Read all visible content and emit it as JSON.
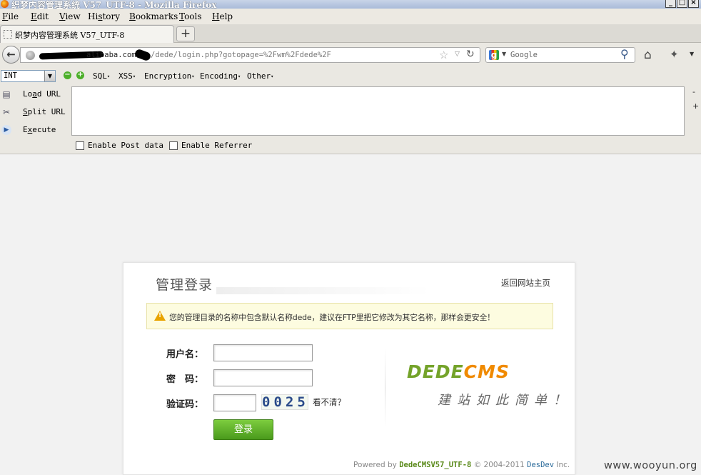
{
  "window": {
    "title": "织梦内容管理系统 V57_UTF-8 - Mozilla Firefox",
    "controls": {
      "minimize": "_",
      "maximize": "□",
      "close": "×"
    }
  },
  "menubar": {
    "items": [
      {
        "label": "File",
        "accel": "F",
        "rest": "ile"
      },
      {
        "label": "Edit",
        "accel": "E",
        "rest": "dit"
      },
      {
        "label": "View",
        "accel": "V",
        "rest": "iew"
      },
      {
        "label": "History",
        "pre": "Hi",
        "accel": "s",
        "rest": "tory"
      },
      {
        "label": "Bookmarks",
        "accel": "B",
        "rest": "ookmarks"
      },
      {
        "label": "Tools",
        "accel": "T",
        "rest": "ools"
      },
      {
        "label": "Help",
        "accel": "H",
        "rest": "elp"
      }
    ]
  },
  "tabs": [
    {
      "title": "织梦内容管理系统 V57_UTF-8",
      "active": true
    }
  ],
  "new_tab": "+",
  "nav": {
    "back": "←",
    "url_host": "alibaba.com",
    "url_path": "/dede/login.php?gotopage=%2Fwm%2Fdede%2F",
    "star": "☆",
    "dropdown": "▽",
    "reload": "↻",
    "search_placeholder": "Google",
    "search_engine_icon": "google-icon",
    "home": "⌂",
    "addon": "✦"
  },
  "hackbar": {
    "type_select": "INT",
    "menus": [
      "SQL",
      "XSS",
      "Encryption",
      "Encoding",
      "Other"
    ],
    "actions": [
      {
        "pre": "Lo",
        "accel": "a",
        "rest": "d URL",
        "icon": "load-url-icon"
      },
      {
        "pre": "",
        "accel": "S",
        "rest": "plit URL",
        "icon": "split-url-icon"
      },
      {
        "pre": "E",
        "accel": "x",
        "rest": "ecute",
        "icon": "execute-icon"
      }
    ],
    "checkboxes": [
      "Enable Post data",
      "Enable Referrer"
    ],
    "side_minus": "-",
    "side_plus": "+"
  },
  "login": {
    "title": "管理登录",
    "home_link": "返回网站主页",
    "notice": "您的管理目录的名称中包含默认名称dede，建议在FTP里把它修改为其它名称，那样会更安全！",
    "username_label": "用户名：",
    "password_label": "密　码：",
    "captcha_label": "验证码：",
    "captcha_code": "0025",
    "captcha_refresh": "看不清？",
    "submit": "登录",
    "logo_dede": "DEDE",
    "logo_cms": "CMS",
    "slogan": "建站如此简单！",
    "footer_powered": "Powered by",
    "footer_product": "DedeCMSV57_UTF-8",
    "footer_copy": "© 2004-2011",
    "footer_company": "DesDev",
    "footer_inc": "Inc."
  },
  "watermark": "www.wooyun.org",
  "colors": {
    "accent_green": "#5a9a1e",
    "logo_orange": "#f08a00",
    "notice_bg": "#fdfce0"
  }
}
